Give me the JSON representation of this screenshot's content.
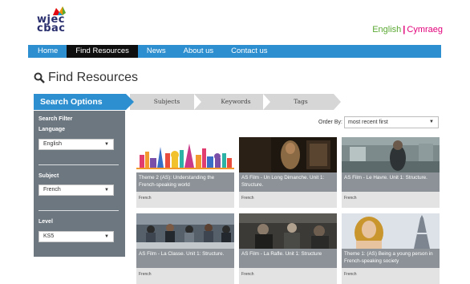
{
  "logo": {
    "line1": "wjec",
    "line2": "cbac"
  },
  "language": {
    "english": "English",
    "separator": "|",
    "welsh": "Cymraeg"
  },
  "nav": {
    "items": [
      {
        "label": "Home",
        "active": false
      },
      {
        "label": "Find Resources",
        "active": true
      },
      {
        "label": "News",
        "active": false
      },
      {
        "label": "About us",
        "active": false
      },
      {
        "label": "Contact us",
        "active": false
      }
    ]
  },
  "page": {
    "title": "Find Resources",
    "icon": "search-icon"
  },
  "steps": {
    "search_options": "Search Options",
    "subjects": "Subjects",
    "keywords": "Keywords",
    "tags": "Tags"
  },
  "sidebar": {
    "filter_title": "Search Filter",
    "language_label": "Language",
    "language_value": "English",
    "subject_label": "Subject",
    "subject_value": "French",
    "level_label": "Level",
    "level_value": "KS5"
  },
  "order": {
    "label": "Order By:",
    "value": "most recent first"
  },
  "cards": [
    {
      "title": "Theme 2 (AS): Understanding the French-speaking world",
      "tag": "French"
    },
    {
      "title": "AS Film - Un Long Dimanche. Unit 1: Structure.",
      "tag": "French"
    },
    {
      "title": "AS Film - Le Havre. Unit 1: Structure.",
      "tag": "French"
    },
    {
      "title": "AS Film - La Classe. Unit 1: Structure.",
      "tag": "French"
    },
    {
      "title": "AS Film - La Rafle. Unit 1: Structure",
      "tag": "French"
    },
    {
      "title": "Theme 1: (AS) Being a young person in French-speaking society",
      "tag": "French"
    }
  ],
  "colors": {
    "brand_blue": "#2d8fd0",
    "english_green": "#5aa832",
    "welsh_pink": "#e2007a",
    "sidebar_grey": "#6d7780"
  }
}
